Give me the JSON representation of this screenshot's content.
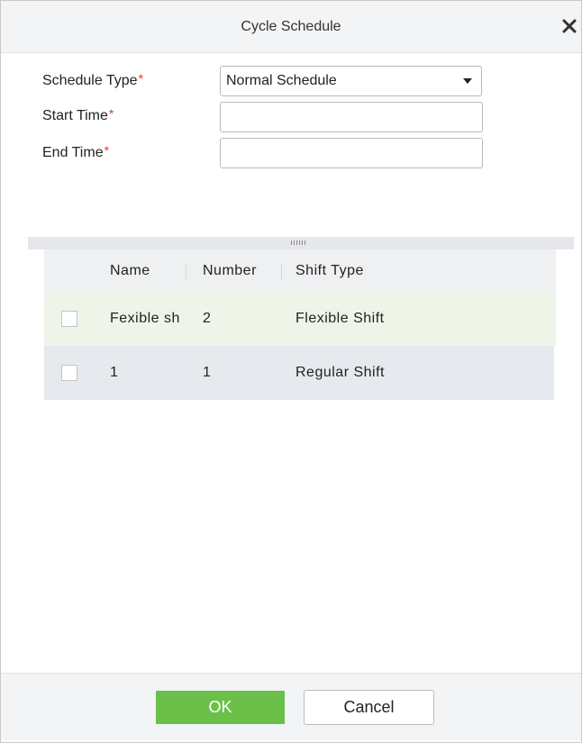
{
  "dialog": {
    "title": "Cycle Schedule",
    "close_icon": "close-icon"
  },
  "form": {
    "schedule_type": {
      "label": "Schedule Type",
      "required_mark": "*",
      "value": "Normal Schedule"
    },
    "start_time": {
      "label": "Start Time",
      "required_mark": "*",
      "value": ""
    },
    "end_time": {
      "label": "End Time",
      "required_mark": "*",
      "value": ""
    }
  },
  "table": {
    "columns": [
      "Name",
      "Number",
      "Shift Type"
    ],
    "rows": [
      {
        "name": "Fexible sh",
        "number": "2",
        "shift_type": "Flexible Shift",
        "checked": false
      },
      {
        "name": "1",
        "number": "1",
        "shift_type": "Regular Shift",
        "checked": false
      }
    ]
  },
  "footer": {
    "ok_label": "OK",
    "cancel_label": "Cancel"
  },
  "colors": {
    "ok_button": "#6cc04a",
    "required": "#e53935",
    "selected_row": "#eef5e8",
    "header_bg": "#f3f4f6"
  }
}
